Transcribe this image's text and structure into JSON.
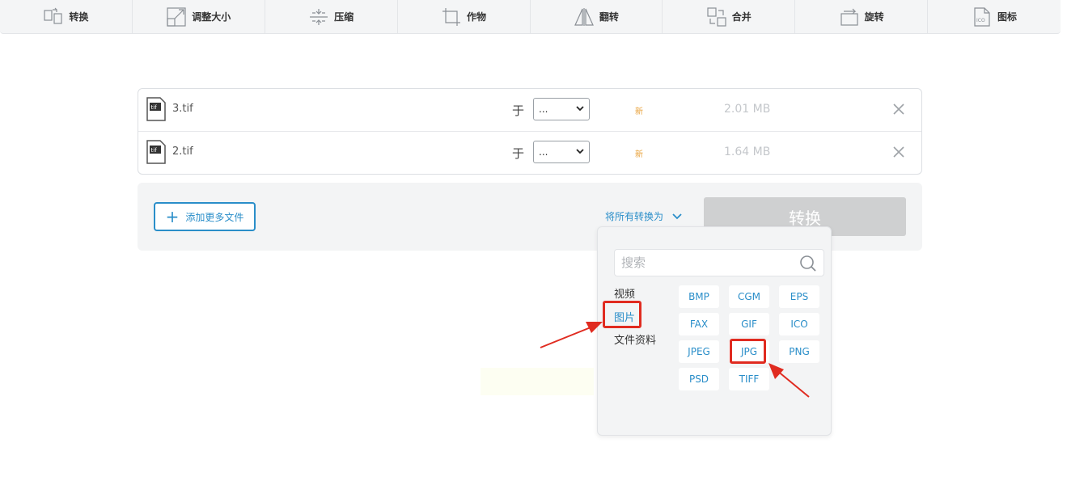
{
  "toolbar": {
    "items": [
      {
        "label": "转换",
        "icon": "convert-icon"
      },
      {
        "label": "调整大小",
        "icon": "resize-icon"
      },
      {
        "label": "压缩",
        "icon": "compress-icon"
      },
      {
        "label": "作物",
        "icon": "crop-icon"
      },
      {
        "label": "翻转",
        "icon": "flip-icon"
      },
      {
        "label": "合并",
        "icon": "merge-icon"
      },
      {
        "label": "旋转",
        "icon": "rotate-icon"
      },
      {
        "label": "图标",
        "icon": "ico-icon"
      }
    ]
  },
  "files": [
    {
      "name": "3.tif",
      "ext": "tif",
      "to_label": "于",
      "target": "...",
      "status": "新",
      "size": "2.01 MB"
    },
    {
      "name": "2.tif",
      "ext": "tif",
      "to_label": "于",
      "target": "...",
      "status": "新",
      "size": "1.64 MB"
    }
  ],
  "actions": {
    "add_more": "添加更多文件",
    "convert_all_to": "将所有转换为",
    "convert": "转换"
  },
  "dropdown": {
    "search_placeholder": "搜索",
    "categories": [
      "视频",
      "图片",
      "文件资料"
    ],
    "active_category": "图片",
    "formats": [
      "BMP",
      "CGM",
      "EPS",
      "FAX",
      "GIF",
      "ICO",
      "JPEG",
      "JPG",
      "PNG",
      "PSD",
      "TIFF"
    ],
    "highlighted_format": "JPG"
  },
  "colors": {
    "accent": "#2a8ec9",
    "status_new": "#e8a13a",
    "annotation": "#e02b20",
    "button_disabled": "#cfd0d1"
  }
}
